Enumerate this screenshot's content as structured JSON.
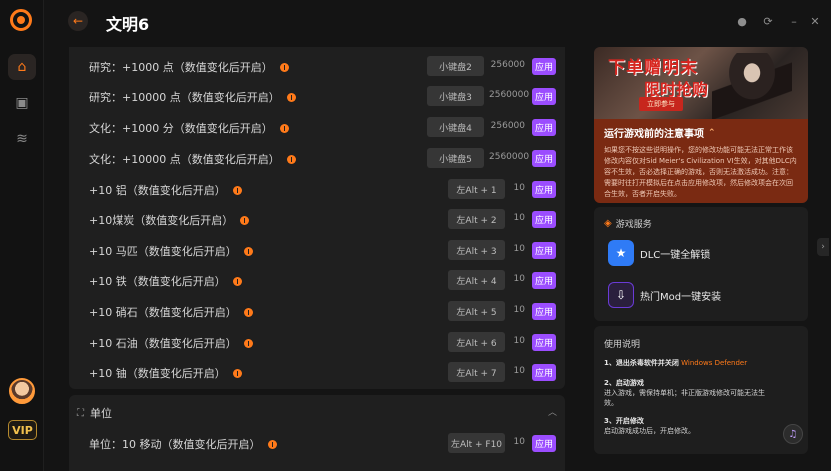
{
  "app": {
    "title": "文明6"
  },
  "rail": {
    "items": [
      {
        "icon": "home-icon",
        "active": true
      },
      {
        "icon": "gamepad-icon",
        "active": false
      },
      {
        "icon": "layers-icon",
        "active": false
      }
    ],
    "vip_label": "VIP"
  },
  "cheats": [
    {
      "label": "研究：+1000 点（数值变化后开启）",
      "key": "小键盘2",
      "value": "256000",
      "apply": "应用"
    },
    {
      "label": "研究：+10000 点（数值变化后开启）",
      "key": "小键盘3",
      "value": "2560000",
      "apply": "应用"
    },
    {
      "label": "文化：+1000 分（数值变化后开启）",
      "key": "小键盘4",
      "value": "256000",
      "apply": "应用"
    },
    {
      "label": "文化：+10000 点（数值变化后开启）",
      "key": "小键盘5",
      "value": "2560000",
      "apply": "应用"
    },
    {
      "label": "+10 铝（数值变化后开启）",
      "key": "左Alt + 1",
      "value": "10",
      "apply": "应用"
    },
    {
      "label": "+10煤炭（数值变化后开启）",
      "key": "左Alt + 2",
      "value": "10",
      "apply": "应用"
    },
    {
      "label": "+10 马匹（数值变化后开启）",
      "key": "左Alt + 3",
      "value": "10",
      "apply": "应用"
    },
    {
      "label": "+10 铁（数值变化后开启）",
      "key": "左Alt + 4",
      "value": "10",
      "apply": "应用"
    },
    {
      "label": "+10 硝石（数值变化后开启）",
      "key": "左Alt + 5",
      "value": "10",
      "apply": "应用"
    },
    {
      "label": "+10 石油（数值变化后开启）",
      "key": "左Alt + 6",
      "value": "10",
      "apply": "应用"
    },
    {
      "label": "+10 铀（数值变化后开启）",
      "key": "左Alt + 7",
      "value": "10",
      "apply": "应用"
    }
  ],
  "unit_section": {
    "title": "单位",
    "rows": [
      {
        "label": "单位：10 移动（数值变化后开启）",
        "key": "左Alt + F10",
        "value": "10",
        "apply": "应用"
      }
    ]
  },
  "banner": {
    "title": "下单赠明末",
    "subtitle": "限时抢购",
    "tag": "立即参与"
  },
  "notice": {
    "title": "运行游戏前的注意事项",
    "body": "如果您不按这些说明操作，您的修改功能可能无法正常工作该修改内容仅对Sid Meier's Civilization VI生效，对其他DLC内容不生效，否必选择正确的游戏，否则无法激活成功。注意：需要时往打开模拟后在点击应用修改项，然后修改项会在次回合生效，否者开启失败。"
  },
  "services": {
    "title": "游戏服务",
    "items": [
      {
        "label": "DLC一键全解锁",
        "color": "#2f7bf6"
      },
      {
        "label": "热门Mod一键安装",
        "color": "#6a3bd6"
      }
    ]
  },
  "guide": {
    "title": "使用说明",
    "steps": [
      {
        "title": "1、退出杀毒软件并关闭",
        "highlight": "Windows Defender",
        "body": ""
      },
      {
        "title": "2、启动游戏",
        "highlight": "",
        "body": "进入游戏，需保持单机；非正版游戏修改可能无法生效。"
      },
      {
        "title": "3、开启修改",
        "highlight": "",
        "body": "启动游戏成功后，开启修改。"
      }
    ]
  },
  "colors": {
    "accent": "#ff7a1a",
    "apply": "#9b4dff",
    "notice": "#7a2a12"
  }
}
